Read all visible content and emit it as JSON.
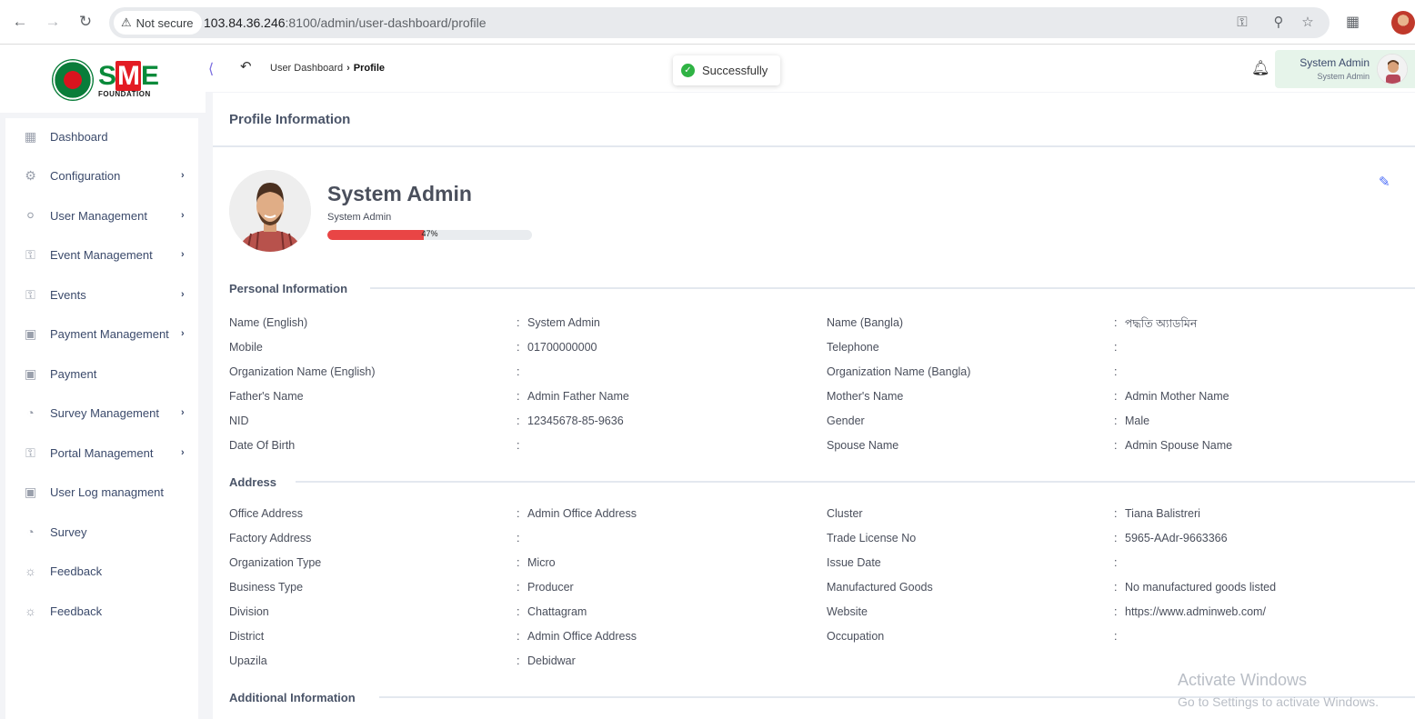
{
  "browser": {
    "security_label": "Not secure",
    "url_host": "103.84.36.246",
    "url_rest": ":8100/admin/user-dashboard/profile"
  },
  "brand": {
    "logo_text_s": "S",
    "logo_text_m": "M",
    "logo_text_e": "E",
    "logo_sub": "FOUNDATION"
  },
  "sidebar": {
    "items": [
      {
        "label": "Dashboard",
        "icon": "grid-icon",
        "has_children": false
      },
      {
        "label": "Configuration",
        "icon": "config-icon",
        "has_children": true
      },
      {
        "label": "User Management",
        "icon": "user-shield-icon",
        "has_children": true
      },
      {
        "label": "Event Management",
        "icon": "lock-icon",
        "has_children": true
      },
      {
        "label": "Events",
        "icon": "lock-icon",
        "has_children": true
      },
      {
        "label": "Payment Management",
        "icon": "payment-icon",
        "has_children": true
      },
      {
        "label": "Payment",
        "icon": "payment-icon",
        "has_children": false
      },
      {
        "label": "Survey Management",
        "icon": "pie-icon",
        "has_children": true
      },
      {
        "label": "Portal Management",
        "icon": "lock-icon",
        "has_children": true
      },
      {
        "label": "User Log managment",
        "icon": "payment-icon",
        "has_children": false
      },
      {
        "label": "Survey",
        "icon": "pie-icon",
        "has_children": false
      },
      {
        "label": "Feedback",
        "icon": "feedback-icon",
        "has_children": false
      },
      {
        "label": "Feedback",
        "icon": "feedback-icon",
        "has_children": false
      }
    ],
    "chevron": "›"
  },
  "topbar": {
    "breadcrumb_parent": "User Dashboard",
    "breadcrumb_sep": "›",
    "breadcrumb_current": "Profile",
    "toast": "Successfully",
    "user_name": "System Admin",
    "user_role": "System Admin"
  },
  "profile": {
    "card_title": "Profile Information",
    "name": "System Admin",
    "role": "System Admin",
    "completion_pct": 47,
    "completion_text": "47%"
  },
  "sections": {
    "personal_title": "Personal Information",
    "address_title": "Address",
    "additional_title": "Additional Information"
  },
  "personal": {
    "left": [
      {
        "label": "Name (English)",
        "value": "System Admin"
      },
      {
        "label": "Mobile",
        "value": "01700000000"
      },
      {
        "label": "Organization Name (English)",
        "value": ""
      },
      {
        "label": "Father's Name",
        "value": "Admin Father Name"
      },
      {
        "label": "NID",
        "value": "12345678-85-9636"
      },
      {
        "label": "Date Of Birth",
        "value": ""
      }
    ],
    "right": [
      {
        "label": "Name (Bangla)",
        "value": "পদ্ধতি অ্যাডমিন"
      },
      {
        "label": "Telephone",
        "value": ""
      },
      {
        "label": "Organization Name (Bangla)",
        "value": ""
      },
      {
        "label": "Mother's Name",
        "value": "Admin Mother Name"
      },
      {
        "label": "Gender",
        "value": "Male"
      },
      {
        "label": "Spouse Name",
        "value": "Admin Spouse Name"
      }
    ]
  },
  "address": {
    "left": [
      {
        "label": "Office Address",
        "value": "Admin Office Address"
      },
      {
        "label": "Factory Address",
        "value": ""
      },
      {
        "label": "Organization Type",
        "value": "Micro"
      },
      {
        "label": "Business Type",
        "value": "Producer"
      },
      {
        "label": "Division",
        "value": "Chattagram"
      },
      {
        "label": "District",
        "value": "Admin Office Address"
      },
      {
        "label": "Upazila",
        "value": "Debidwar"
      }
    ],
    "right": [
      {
        "label": "Cluster",
        "value": "Tiana Balistreri"
      },
      {
        "label": "Trade License No",
        "value": "5965-AAdr-9663366"
      },
      {
        "label": "Issue Date",
        "value": ""
      },
      {
        "label": "Manufactured Goods",
        "value": "No manufactured goods listed"
      },
      {
        "label": "Website",
        "value": "https://www.adminweb.com/"
      },
      {
        "label": "Occupation",
        "value": ""
      }
    ]
  },
  "colon": ":",
  "watermark": {
    "line1": "Activate Windows",
    "line2": "Go to Settings to activate Windows."
  },
  "colors": {
    "progress_fill": "#e94545",
    "toast_ok": "#2fb344",
    "accent": "#4a6cf7"
  }
}
